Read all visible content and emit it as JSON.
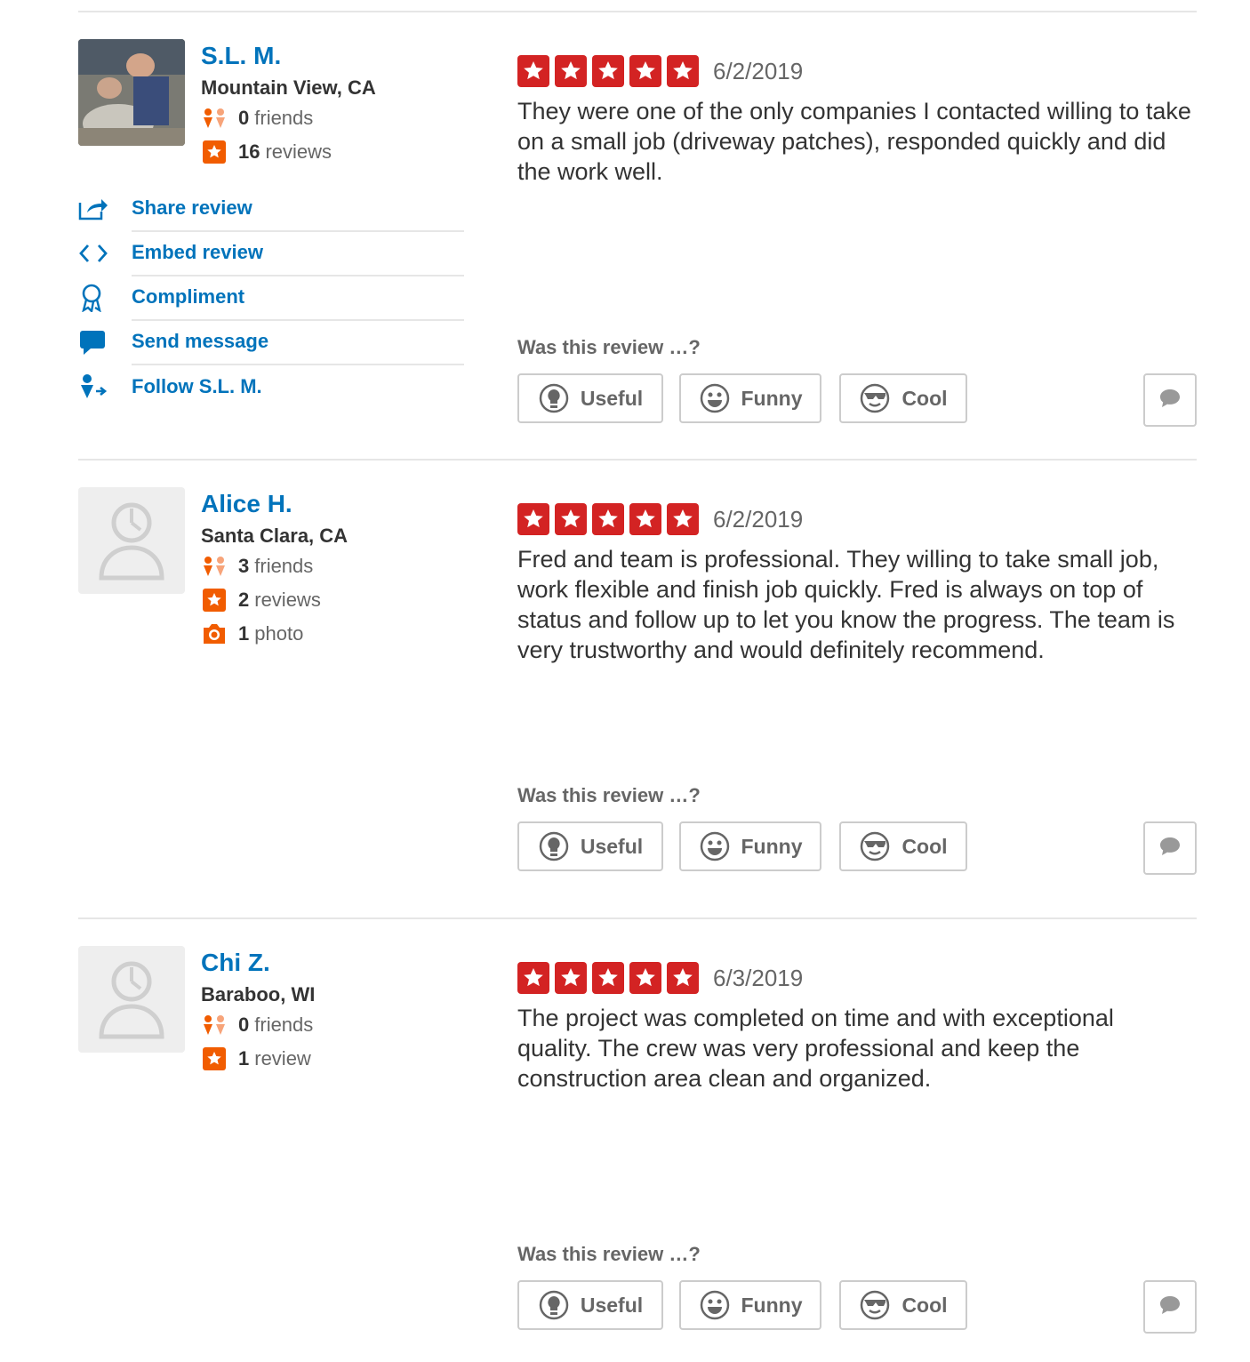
{
  "review_prompt": "Was this review …?",
  "vote_labels": {
    "useful": "Useful",
    "funny": "Funny",
    "cool": "Cool"
  },
  "colors": {
    "link": "#0073bb",
    "star": "#d32323",
    "stat_icon": "#f15c00"
  },
  "reviews": [
    {
      "user": {
        "name": "S.L. M.",
        "location": "Mountain View, CA",
        "friends_count": "0",
        "friends_label": "friends",
        "reviews_count": "16",
        "reviews_label": "reviews"
      },
      "rating": 5,
      "date": "6/2/2019",
      "text": "They were one of the only companies I contacted willing to take on a small job (driveway patches), responded quickly and did the work well.",
      "actions": [
        {
          "icon": "share-icon",
          "label": "Share review"
        },
        {
          "icon": "embed-icon",
          "label": "Embed review"
        },
        {
          "icon": "compliment-icon",
          "label": "Compliment"
        },
        {
          "icon": "message-icon",
          "label": "Send message"
        },
        {
          "icon": "follow-icon",
          "label": "Follow S.L. M."
        }
      ]
    },
    {
      "user": {
        "name": "Alice H.",
        "location": "Santa Clara, CA",
        "friends_count": "3",
        "friends_label": "friends",
        "reviews_count": "2",
        "reviews_label": "reviews",
        "photos_count": "1",
        "photos_label": "photo"
      },
      "rating": 5,
      "date": "6/2/2019",
      "text": "Fred and team is professional. They willing to take small job, work flexible and finish job quickly. Fred is always on top of status and follow up to let you know the progress. The team is very trustworthy and would definitely recommend."
    },
    {
      "user": {
        "name": "Chi Z.",
        "location": "Baraboo, WI",
        "friends_count": "0",
        "friends_label": "friends",
        "reviews_count": "1",
        "reviews_label": "review"
      },
      "rating": 5,
      "date": "6/3/2019",
      "text": "The project was completed on time and with exceptional quality. The crew was very professional and keep the construction area clean and organized."
    }
  ]
}
